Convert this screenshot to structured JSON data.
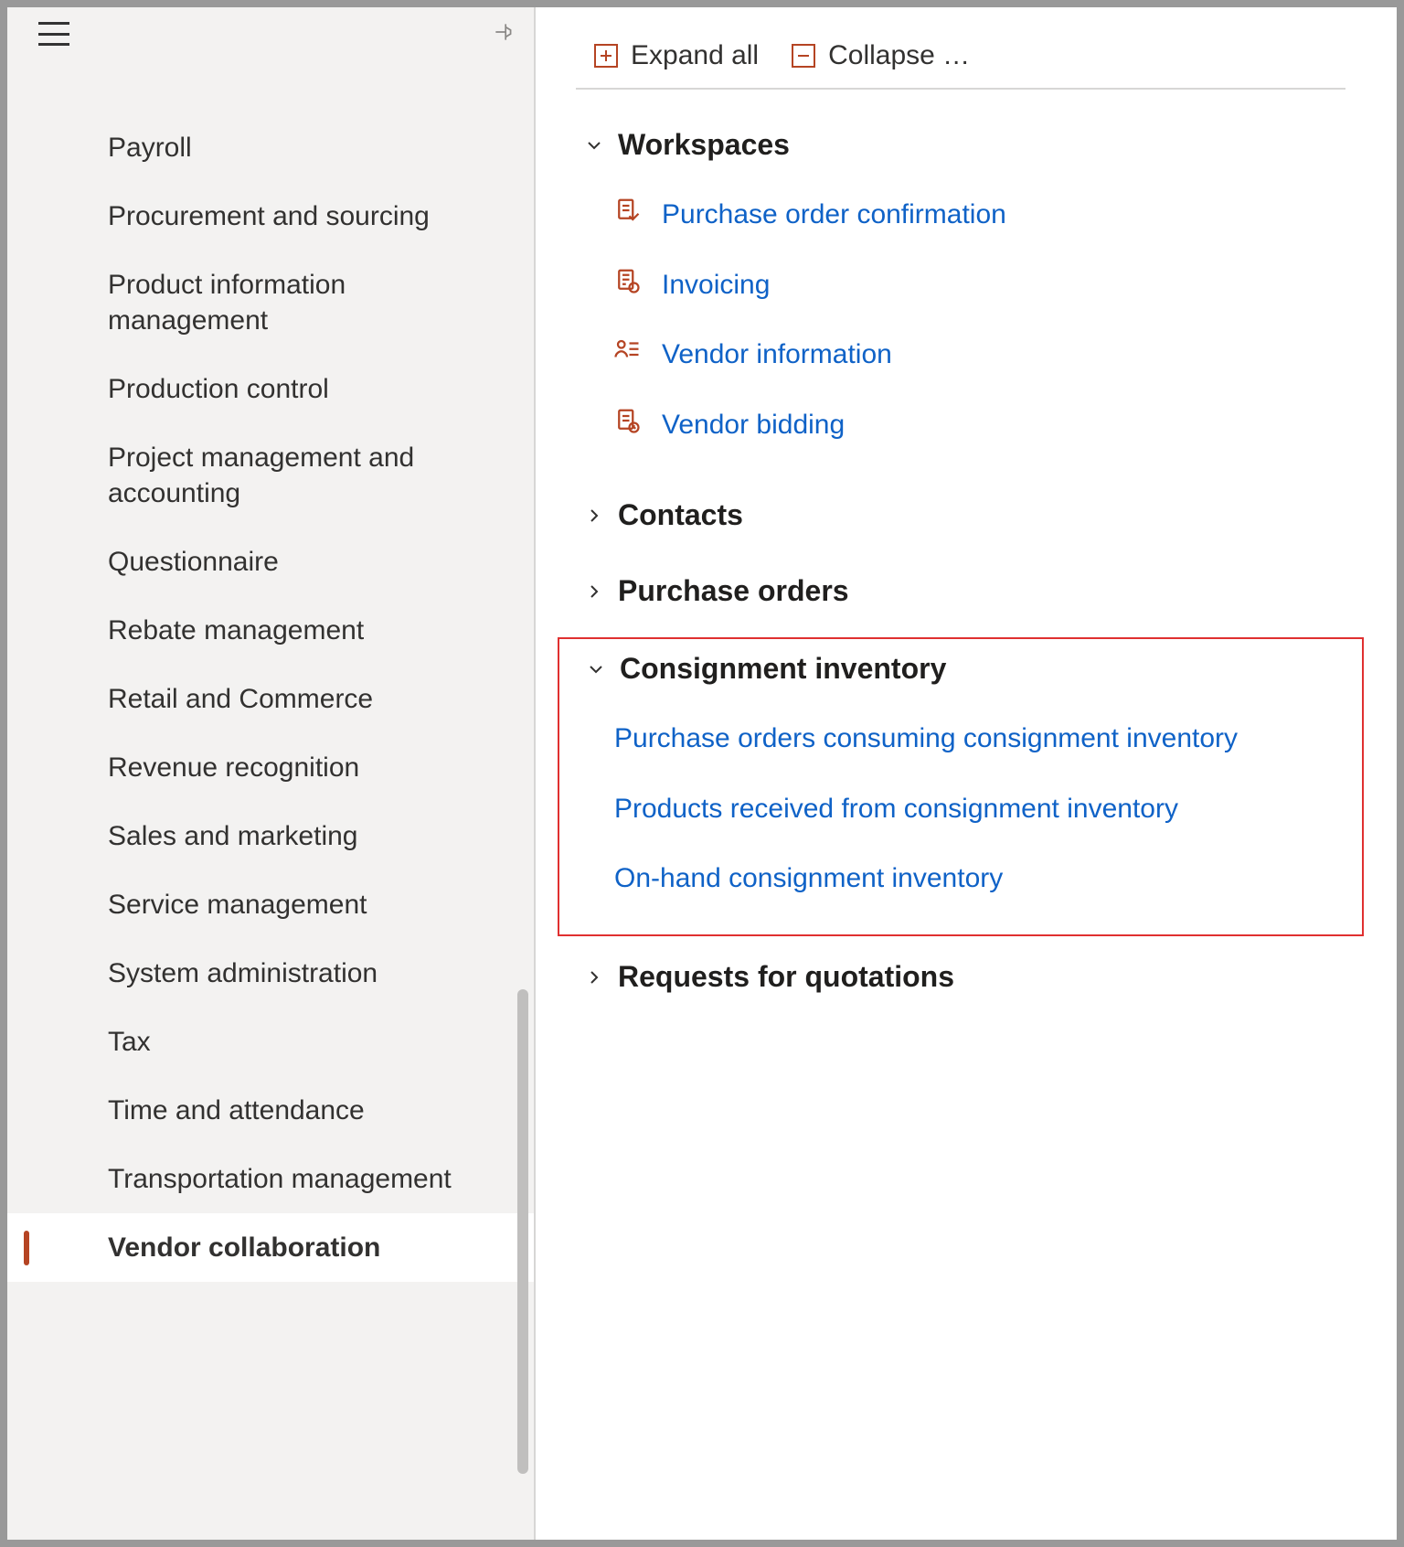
{
  "sidebar": {
    "items": [
      {
        "label": "Payroll"
      },
      {
        "label": "Procurement and sourcing"
      },
      {
        "label": "Product information management"
      },
      {
        "label": "Production control"
      },
      {
        "label": "Project management and accounting"
      },
      {
        "label": "Questionnaire"
      },
      {
        "label": "Rebate management"
      },
      {
        "label": "Retail and Commerce"
      },
      {
        "label": "Revenue recognition"
      },
      {
        "label": "Sales and marketing"
      },
      {
        "label": "Service management"
      },
      {
        "label": "System administration"
      },
      {
        "label": "Tax"
      },
      {
        "label": "Time and attendance"
      },
      {
        "label": "Transportation management"
      },
      {
        "label": "Vendor collaboration"
      }
    ],
    "selected_index": 15
  },
  "toolbar": {
    "expand_label": "Expand all",
    "collapse_label": "Collapse …"
  },
  "sections": {
    "workspaces": {
      "title": "Workspaces",
      "expanded": true,
      "links": [
        {
          "label": "Purchase order confirmation",
          "icon": "po-confirm"
        },
        {
          "label": "Invoicing",
          "icon": "invoice"
        },
        {
          "label": "Vendor information",
          "icon": "person-list"
        },
        {
          "label": "Vendor bidding",
          "icon": "bid"
        }
      ]
    },
    "contacts": {
      "title": "Contacts",
      "expanded": false
    },
    "purchase_orders": {
      "title": "Purchase orders",
      "expanded": false
    },
    "consignment": {
      "title": "Consignment inventory",
      "expanded": true,
      "highlighted": true,
      "links": [
        {
          "label": "Purchase orders consuming consignment inventory"
        },
        {
          "label": "Products received from consignment inventory"
        },
        {
          "label": "On-hand consignment inventory"
        }
      ]
    },
    "rfq": {
      "title": "Requests for quotations",
      "expanded": false
    }
  }
}
